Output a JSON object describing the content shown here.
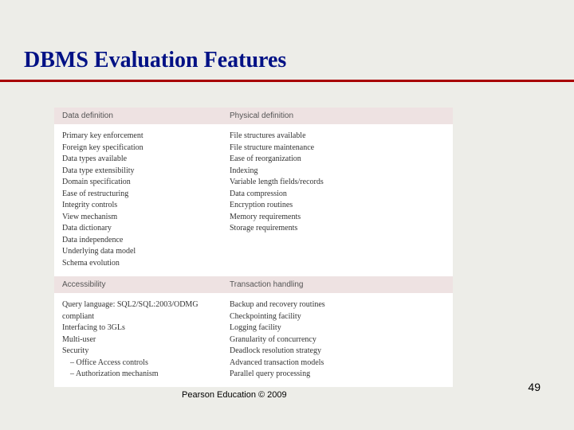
{
  "title": "DBMS Evaluation Features",
  "chart_data": {
    "type": "table",
    "sections": [
      {
        "headers": [
          "Data definition",
          "Physical definition"
        ],
        "rows": {
          "left": [
            "Primary key enforcement",
            "Foreign key specification",
            "Data types available",
            "Data type extensibility",
            "Domain specification",
            "Ease of restructuring",
            "Integrity controls",
            "View mechanism",
            "Data dictionary",
            "Data independence",
            "Underlying data model",
            "Schema evolution"
          ],
          "right": [
            "File structures available",
            "File structure maintenance",
            "Ease of reorganization",
            "Indexing",
            "Variable length fields/records",
            "Data compression",
            "Encryption routines",
            "Memory requirements",
            "Storage requirements"
          ]
        }
      },
      {
        "headers": [
          "Accessibility",
          "Transaction handling"
        ],
        "rows": {
          "left": [
            "Query language: SQL2/SQL:2003/ODMG compliant",
            "Interfacing to 3GLs",
            "Multi-user",
            "Security",
            "–  Office Access controls",
            "–  Authorization mechanism"
          ],
          "right": [
            "Backup and recovery routines",
            "Checkpointing facility",
            "Logging facility",
            "Granularity of concurrency",
            "Deadlock resolution strategy",
            "Advanced transaction models",
            "Parallel query processing"
          ]
        }
      }
    ]
  },
  "footer": {
    "copyright": "Pearson Education © 2009",
    "page_number": "49"
  }
}
